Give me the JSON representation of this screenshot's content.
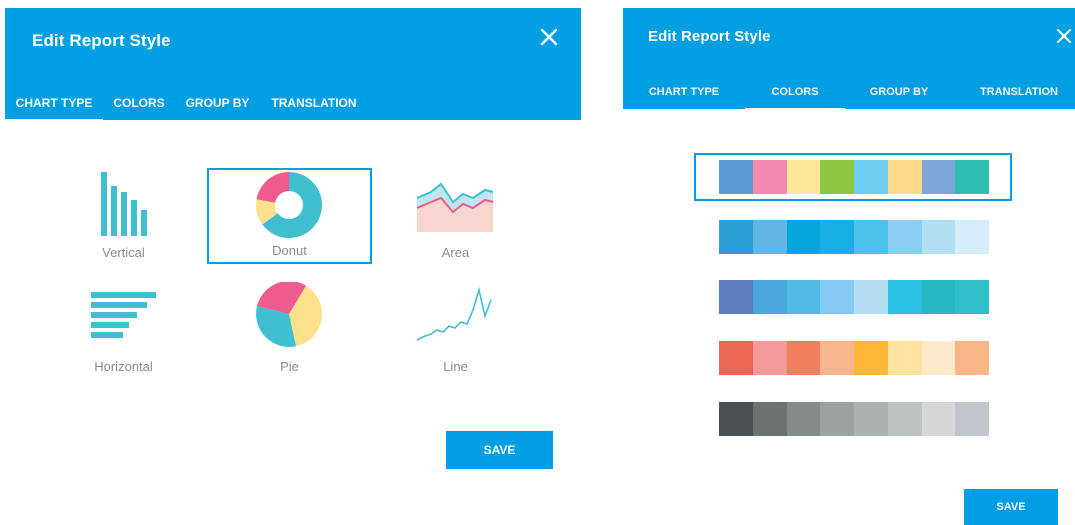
{
  "left": {
    "title": "Edit Report Style",
    "tabs": [
      "CHART TYPE",
      "COLORS",
      "GROUP BY",
      "TRANSLATION"
    ],
    "active_tab": "CHART TYPE",
    "chart_types": [
      {
        "label": "Vertical",
        "icon": "vertical-bar-chart-icon",
        "selected": false
      },
      {
        "label": "Donut",
        "icon": "donut-chart-icon",
        "selected": true
      },
      {
        "label": "Area",
        "icon": "area-chart-icon",
        "selected": false
      },
      {
        "label": "Horizontal",
        "icon": "horizontal-bar-chart-icon",
        "selected": false
      },
      {
        "label": "Pie",
        "icon": "pie-chart-icon",
        "selected": false
      },
      {
        "label": "Line",
        "icon": "line-chart-icon",
        "selected": false
      }
    ],
    "save_label": "SAVE"
  },
  "right": {
    "title": "Edit Report Style",
    "tabs": [
      "CHART TYPE",
      "COLORS",
      "GROUP BY",
      "TRANSLATION"
    ],
    "active_tab": "COLORS",
    "palettes": [
      [
        "#5b9bd5",
        "#f289b1",
        "#fde79a",
        "#8dc63f",
        "#6fcdee",
        "#fdd98b",
        "#7da7d9",
        "#2ebdb2"
      ],
      [
        "#2b9fd3",
        "#61b4e4",
        "#07a6df",
        "#17afe6",
        "#4cc1ec",
        "#89cff2",
        "#b3dff5",
        "#d5ecf9"
      ],
      [
        "#5b7ec0",
        "#4ba6dc",
        "#51b8e8",
        "#85c8f0",
        "#b4dcf3",
        "#27bfe2",
        "#25b8c2",
        "#2ebfc8"
      ],
      [
        "#ee6655",
        "#f39a9a",
        "#f07f5e",
        "#f7b68d",
        "#fdb838",
        "#fde2a0",
        "#fdeacc",
        "#fbb687"
      ],
      [
        "#4a5052",
        "#6c7272",
        "#868a8a",
        "#9ea1a2",
        "#aeb1b1",
        "#bfc2c2",
        "#d5d6d6",
        "#c2c6cc"
      ]
    ],
    "selected_palette": 0,
    "save_label": "SAVE"
  },
  "colors": {
    "accent": "#009ee3",
    "teal": "#3fbfd0",
    "pink": "#ef5a8f",
    "yellow": "#fde08c"
  }
}
